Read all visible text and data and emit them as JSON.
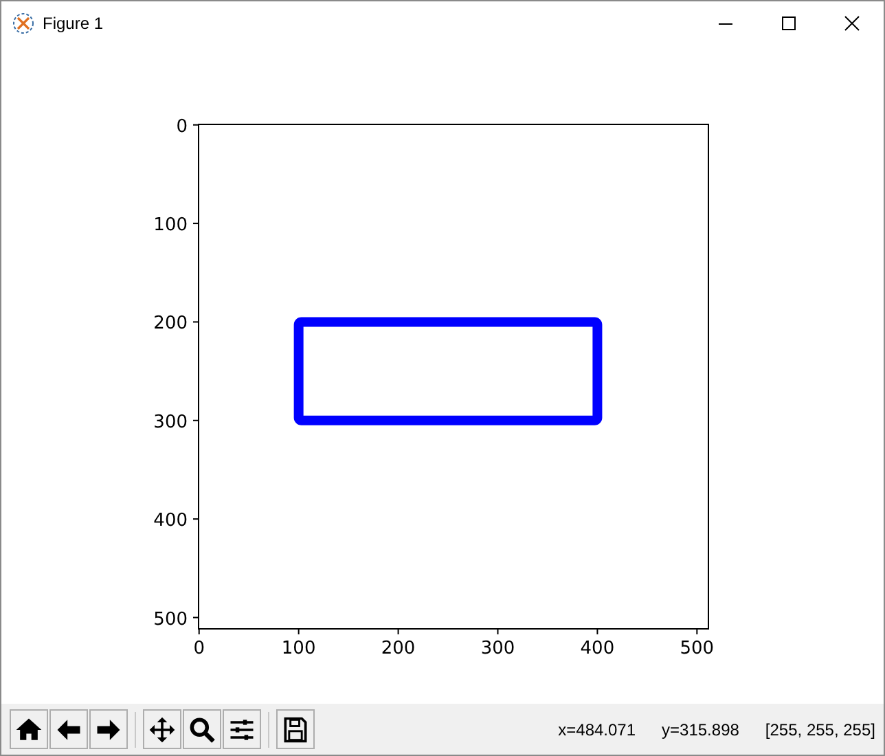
{
  "window": {
    "title": "Figure 1"
  },
  "figure": {
    "x_tick_labels": [
      "0",
      "100",
      "200",
      "300",
      "400",
      "500"
    ],
    "y_tick_labels": [
      "0",
      "100",
      "200",
      "300",
      "400",
      "500"
    ]
  },
  "toolbar": {
    "buttons": [
      {
        "kind": "home"
      },
      {
        "kind": "back"
      },
      {
        "kind": "forward"
      },
      {
        "kind": "sep"
      },
      {
        "kind": "pan"
      },
      {
        "kind": "zoom"
      },
      {
        "kind": "configure"
      },
      {
        "kind": "sep"
      },
      {
        "kind": "save"
      }
    ],
    "status": [
      "x=484.071",
      "y=315.898",
      "[255, 255, 255]"
    ]
  }
}
